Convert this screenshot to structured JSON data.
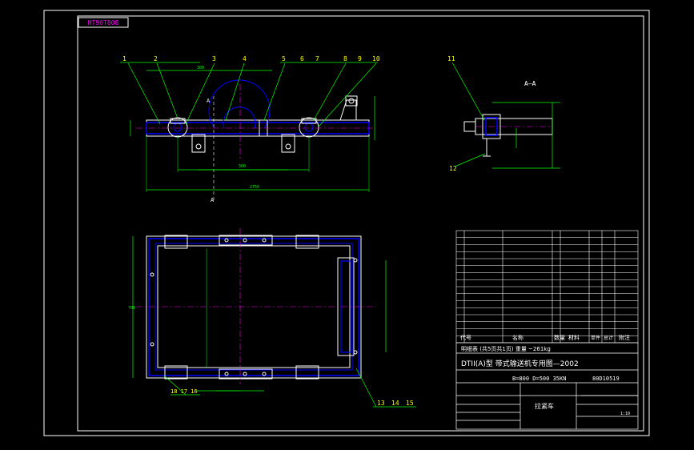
{
  "drawing": {
    "code_tag": "HT90T808",
    "section_label": "A—A",
    "view_mark": "A",
    "callouts_top": [
      "1",
      "2",
      "3",
      "4",
      "5",
      "6",
      "7",
      "8",
      "9",
      "10"
    ],
    "callouts_section": [
      "11",
      "12"
    ],
    "callouts_bottom": [
      "13",
      "14",
      "15"
    ],
    "callout_bottom_left": "18 17 16",
    "dimensions": [
      "300",
      "300",
      "2750",
      "700"
    ]
  },
  "title_block": {
    "main_title": "DTII(A)型 带式输送机专用图—2002",
    "spec_line": "B=800 D=500 35KN",
    "drawing_no": "80D10519",
    "part_name": "拉紧车",
    "header_cols": [
      "代号",
      "名称",
      "数量",
      "材料",
      "单件",
      "总计",
      "附注"
    ],
    "weight_row": "明细表 (共5页共1页) 重量 ~261kg",
    "scale": "1:10"
  },
  "colors": {
    "frame": "#ffffff",
    "steel": "#0000ff",
    "dimension": "#00ff00",
    "callout": "#ffff00",
    "text": "#ff00ff",
    "accent": "#ff0000",
    "centerline": "#ff00ff"
  }
}
